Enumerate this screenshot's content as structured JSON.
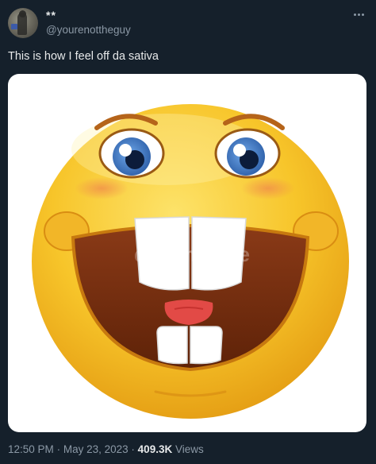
{
  "user": {
    "display_name": "**",
    "handle": "@yourenottheguy"
  },
  "tweet": {
    "text": "This is how I feel off da sativa",
    "media_watermark": "dreamstime"
  },
  "meta": {
    "time": "12:50 PM",
    "separator": "·",
    "date": "May 23, 2023",
    "views_count": "409.3K",
    "views_label": "Views"
  },
  "icons": {
    "more": "more-options-icon",
    "avatar": "avatar-image"
  },
  "colors": {
    "background": "#15202b",
    "primary_text": "#e7e9ea",
    "secondary_text": "#8b98a5",
    "emoji_yellow": "#f7c52a"
  }
}
